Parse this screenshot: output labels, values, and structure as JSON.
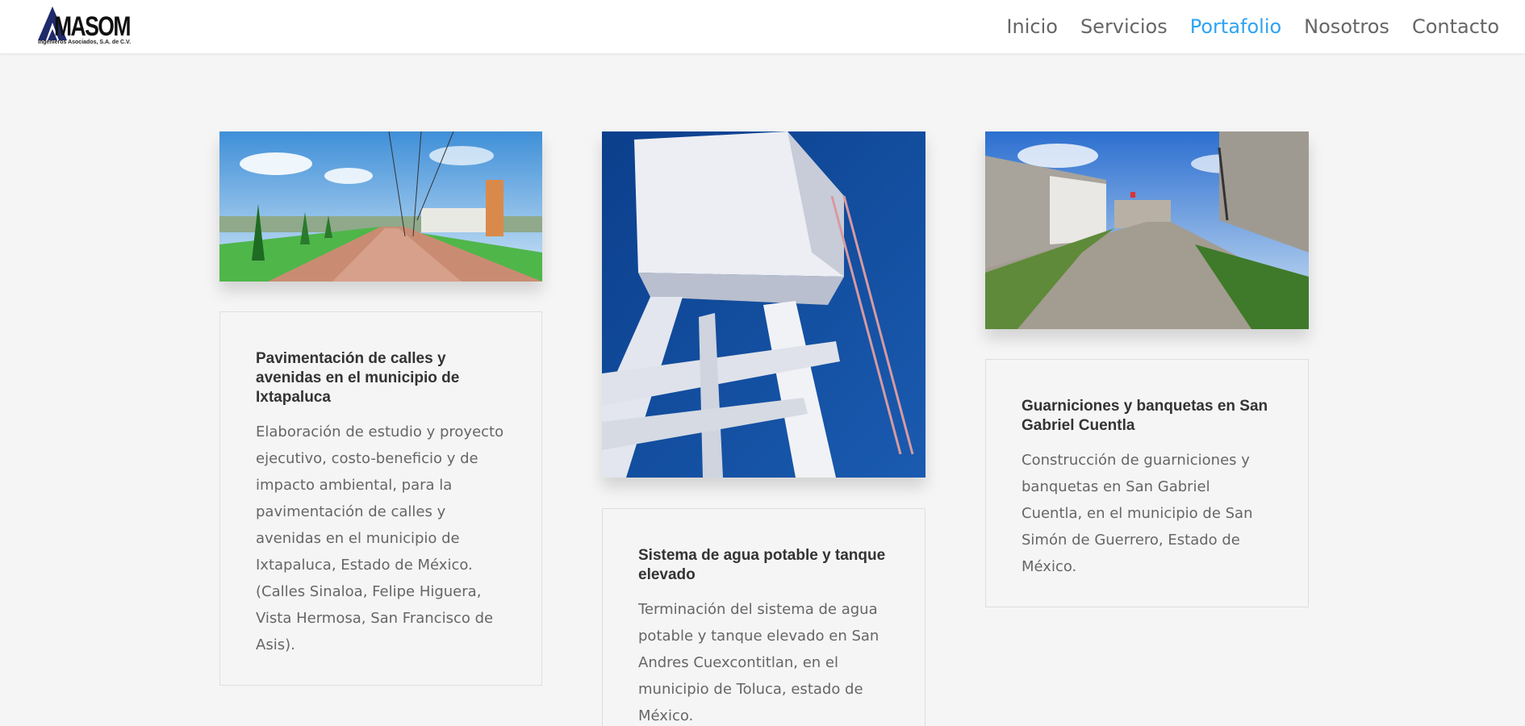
{
  "brand": {
    "wordmark": "MASOM",
    "tagline": "Ingenieros Asociados, S.A. de C.V."
  },
  "nav": {
    "items": [
      "Inicio",
      "Servicios",
      "Portafolio",
      "Nosotros",
      "Contacto"
    ],
    "active_index": 2,
    "active_color": "#2ea3f2"
  },
  "projects": [
    {
      "title": "Pavimentación de calles y avenidas en el municipio de Ixtapaluca",
      "description": "Elaboración de estudio y proyecto ejecutivo, costo-beneficio y de impacto ambiental, para la pavimentación de calles y avenidas en el municipio de Ixtapaluca, Estado de México. (Calles Sinaloa, Felipe Higuera, Vista Hermosa, San Francisco de Asis)."
    },
    {
      "title": "Sistema de agua potable y tanque elevado",
      "description": "Terminación del sistema de agua potable y tanque elevado en San Andres Cuexcontitlan, en el municipio de Toluca, estado de México."
    },
    {
      "title": "Guarniciones y banquetas en San Gabriel Cuentla",
      "description": "Construcción de guarniciones y banquetas en San Gabriel Cuentla, en el municipio de San Simón de Guerrero, Estado de México."
    }
  ]
}
